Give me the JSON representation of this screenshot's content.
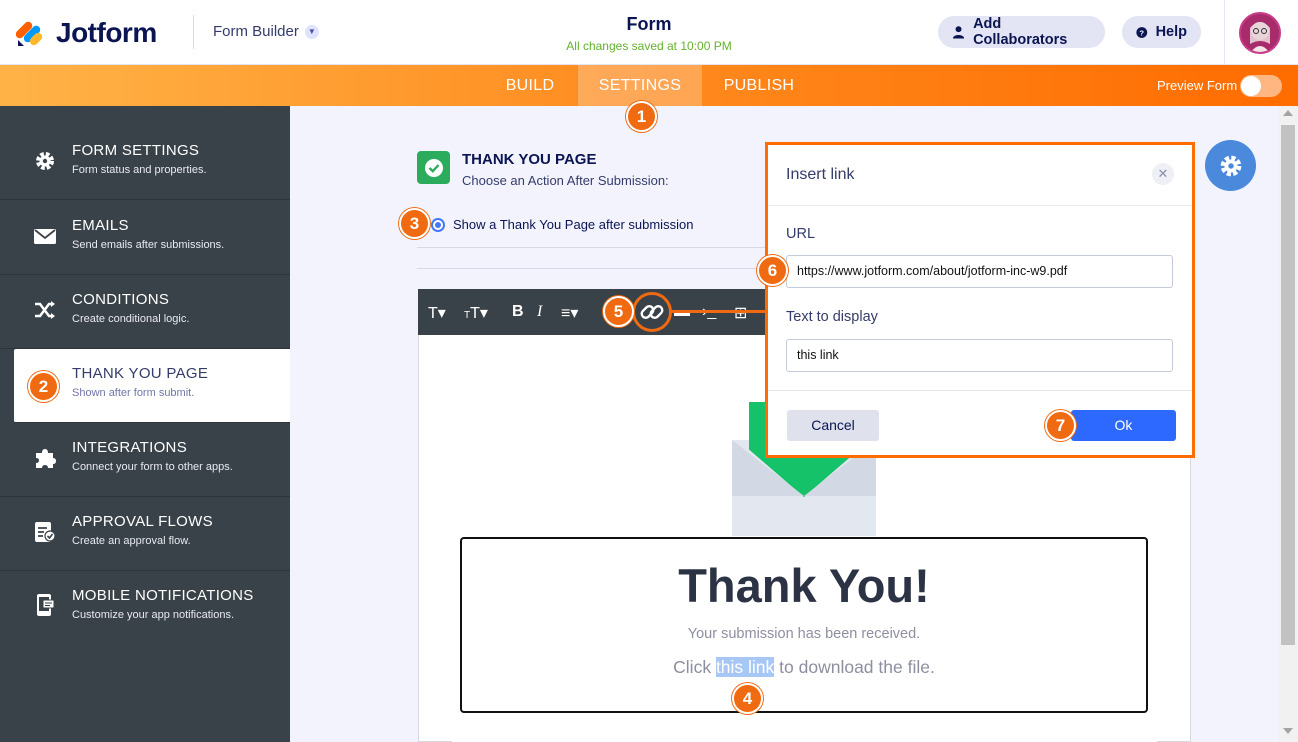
{
  "header": {
    "logo_text": "Jotform",
    "builder_label": "Form Builder",
    "form_title": "Form",
    "saved_status": "All changes saved at 10:00 PM",
    "collaborators_label": "Add Collaborators",
    "help_label": "Help"
  },
  "nav": {
    "build": "BUILD",
    "settings": "SETTINGS",
    "publish": "PUBLISH",
    "preview_label": "Preview Form"
  },
  "sidebar": {
    "items": [
      {
        "title": "FORM SETTINGS",
        "subtitle": "Form status and properties."
      },
      {
        "title": "EMAILS",
        "subtitle": "Send emails after submissions."
      },
      {
        "title": "CONDITIONS",
        "subtitle": "Create conditional logic."
      },
      {
        "title": "THANK YOU PAGE",
        "subtitle": "Shown after form submit."
      },
      {
        "title": "INTEGRATIONS",
        "subtitle": "Connect your form to other apps."
      },
      {
        "title": "APPROVAL FLOWS",
        "subtitle": "Create an approval flow."
      },
      {
        "title": "MOBILE NOTIFICATIONS",
        "subtitle": "Customize your app notifications."
      }
    ]
  },
  "thankyou": {
    "title": "THANK YOU PAGE",
    "subtitle": "Choose an Action After Submission:",
    "radio_label": "Show a Thank You Page after submission",
    "heading": "Thank You!",
    "received": "Your submission has been received.",
    "click_prefix": "Click ",
    "link_text": "this link",
    "click_suffix": " to download the file."
  },
  "modal": {
    "title": "Insert link",
    "close_glyph": "✕",
    "url_label": "URL",
    "url_value": "https://www.jotform.com/about/jotform-inc-w9.pdf",
    "display_label": "Text to display",
    "display_value": "this link",
    "cancel_label": "Cancel",
    "ok_label": "Ok"
  },
  "steps": [
    "1",
    "2",
    "3",
    "4",
    "5",
    "6",
    "7"
  ],
  "colors": {
    "accent": "#ff6c00",
    "sidebar": "#394249",
    "primary_button": "#2e69ff",
    "success": "#2bac5d"
  }
}
